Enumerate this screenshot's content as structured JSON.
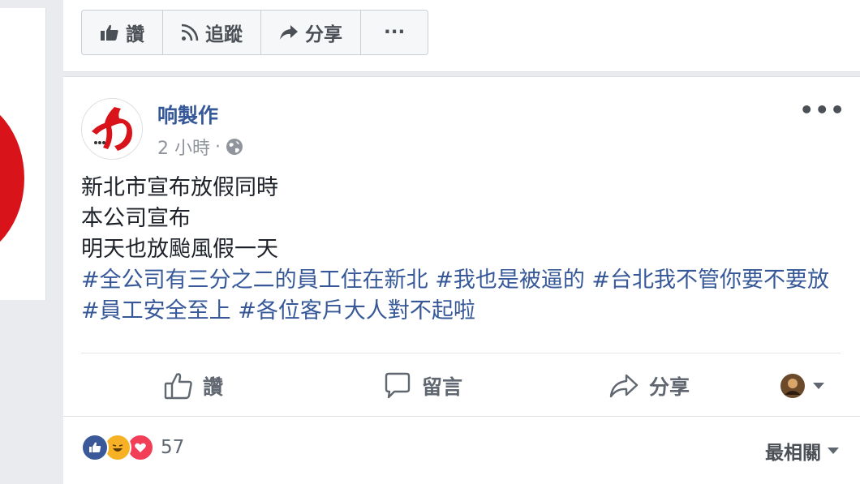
{
  "top_bar": {
    "like_label": "讚",
    "follow_label": "追蹤",
    "share_label": "分享",
    "more_label": "···"
  },
  "post": {
    "page_name": "响製作",
    "time": "2 小時",
    "separator": "·",
    "lines": [
      "新北市宣布放假同時",
      "本公司宣布",
      "明天也放颱風假一天"
    ],
    "hashtags": "#全公司有三分之二的員工住在新北 #我也是被逼的 #台北我不管你要不要放 #員工安全至上 #各位客戶大人對不起啦"
  },
  "actions": {
    "like": "讚",
    "comment": "留言",
    "share": "分享"
  },
  "reactions": {
    "count": "57",
    "sort_label": "最相關",
    "types": [
      "like",
      "haha",
      "love"
    ]
  },
  "colors": {
    "link": "#365899",
    "brand_red": "#d8131a",
    "like_blue": "#3b5998",
    "love_red": "#f33e58",
    "haha_yellow": "#f7b125"
  },
  "icons": [
    "thumbs-up-icon",
    "rss-icon",
    "share-arrow-icon",
    "globe-icon",
    "comment-icon",
    "caret-down-icon"
  ]
}
